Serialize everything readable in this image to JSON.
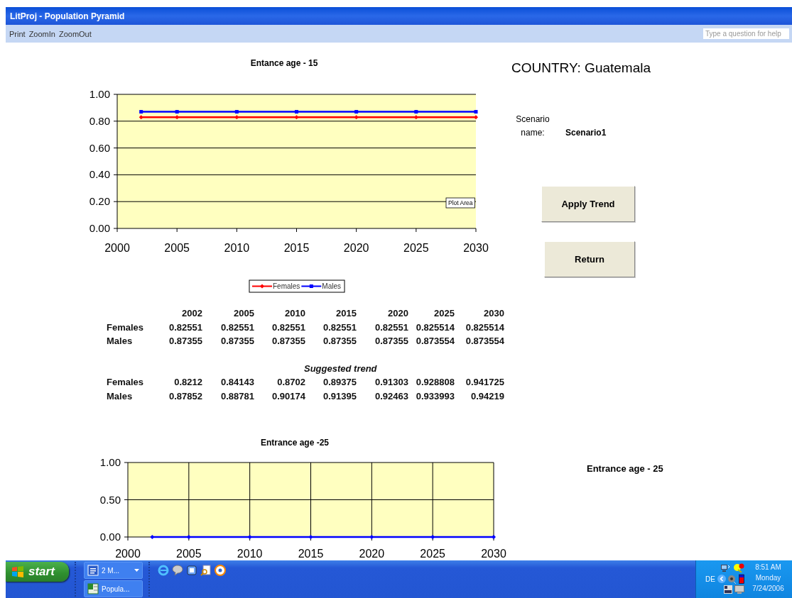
{
  "window": {
    "title": "LitProj - Population Pyramid"
  },
  "menu": [
    "Print",
    "ZoomIn",
    "ZoomOut"
  ],
  "help_box": {
    "placeholder": "Type a question for help"
  },
  "chart_1": {
    "tooltip": "Plot Area",
    "chart_data": {
      "type": "line",
      "title": "Entance age - 15",
      "x": [
        2002,
        2005,
        2010,
        2015,
        2020,
        2025,
        2030
      ],
      "series": [
        {
          "name": "Females",
          "color": "#ff0000",
          "marker": "diamond",
          "values": [
            0.83,
            0.83,
            0.83,
            0.83,
            0.83,
            0.83,
            0.83
          ]
        },
        {
          "name": "Males",
          "color": "#0000ff",
          "marker": "square",
          "values": [
            0.87,
            0.87,
            0.87,
            0.87,
            0.87,
            0.87,
            0.87
          ]
        }
      ],
      "grid": {
        "x": false,
        "y": true
      },
      "legend": true,
      "xlim": [
        2000,
        2030
      ],
      "ylim": [
        0,
        1
      ],
      "xticks": [
        {
          "value": 2000,
          "label": "2000"
        },
        {
          "value": 2005,
          "label": "2005"
        },
        {
          "value": 2010,
          "label": "2010"
        },
        {
          "value": 2015,
          "label": "2015"
        },
        {
          "value": 2020,
          "label": "2020"
        },
        {
          "value": 2025,
          "label": "2025"
        },
        {
          "value": 2030,
          "label": "2030"
        }
      ],
      "yticks": [
        {
          "value": 0,
          "label": "0.00"
        },
        {
          "value": 0.2,
          "label": "0.20"
        },
        {
          "value": 0.4,
          "label": "0.40"
        },
        {
          "value": 0.6,
          "label": "0.60"
        },
        {
          "value": 0.8,
          "label": "0.80"
        },
        {
          "value": 1,
          "label": "1.00"
        }
      ]
    }
  },
  "table": {
    "columns": [
      "2002",
      "2005",
      "2010",
      "2015",
      "2020",
      "2025",
      "2030"
    ],
    "rows": [
      {
        "label": "Females",
        "values": [
          "0.82551",
          "0.82551",
          "0.82551",
          "0.82551",
          "0.82551",
          "0.825514",
          "0.825514"
        ]
      },
      {
        "label": "Males",
        "values": [
          "0.87355",
          "0.87355",
          "0.87355",
          "0.87355",
          "0.87355",
          "0.873554",
          "0.873554"
        ]
      }
    ]
  },
  "suggested_trend": {
    "title": "Suggested trend",
    "rows": [
      {
        "label": "Females",
        "values": [
          "0.8212",
          "0.84143",
          "0.8702",
          "0.89375",
          "0.91303",
          "0.928808",
          "0.941725"
        ]
      },
      {
        "label": "Males",
        "values": [
          "0.87852",
          "0.88781",
          "0.90174",
          "0.91395",
          "0.92463",
          "0.933993",
          "0.94219"
        ]
      }
    ]
  },
  "chart_2": {
    "chart_data": {
      "type": "line",
      "title": "Entrance age -25",
      "x": [
        2002,
        2005,
        2010,
        2015,
        2020,
        2025,
        2030
      ],
      "series": [
        {
          "color": "#0000ff",
          "marker": "diamond",
          "values": [
            0,
            0,
            0,
            0,
            0,
            0,
            0
          ]
        }
      ],
      "grid": {
        "x": true,
        "y": true
      },
      "xlim": [
        2000,
        2030
      ],
      "ylim": [
        0,
        1
      ],
      "xticks": [
        {
          "value": 2000,
          "label": "2000"
        },
        {
          "value": 2005,
          "label": "2005"
        },
        {
          "value": 2010,
          "label": "2010"
        },
        {
          "value": 2015,
          "label": "2015"
        },
        {
          "value": 2020,
          "label": "2020"
        },
        {
          "value": 2025,
          "label": "2025"
        },
        {
          "value": 2030,
          "label": "2030"
        }
      ],
      "yticks": [
        {
          "value": 0,
          "label": "0.00"
        },
        {
          "value": 0.5,
          "label": "0.50"
        },
        {
          "value": 1,
          "label": "1.00"
        }
      ]
    }
  },
  "country": "COUNTRY: Guatemala",
  "scenario": {
    "label": "Scenario name:",
    "value": "Scenario1"
  },
  "buttons": [
    "Apply Trend",
    "Return"
  ],
  "side_label": "Entrance age - 25",
  "taskbar": {
    "start": "start",
    "tasks": [
      {
        "label": "2 M...",
        "kind": "word"
      },
      {
        "label": "Popula...",
        "kind": "excel"
      }
    ],
    "tray": {
      "language": "DE",
      "time": "8:51 AM",
      "day": "Monday",
      "date": "7/24/2006"
    }
  }
}
